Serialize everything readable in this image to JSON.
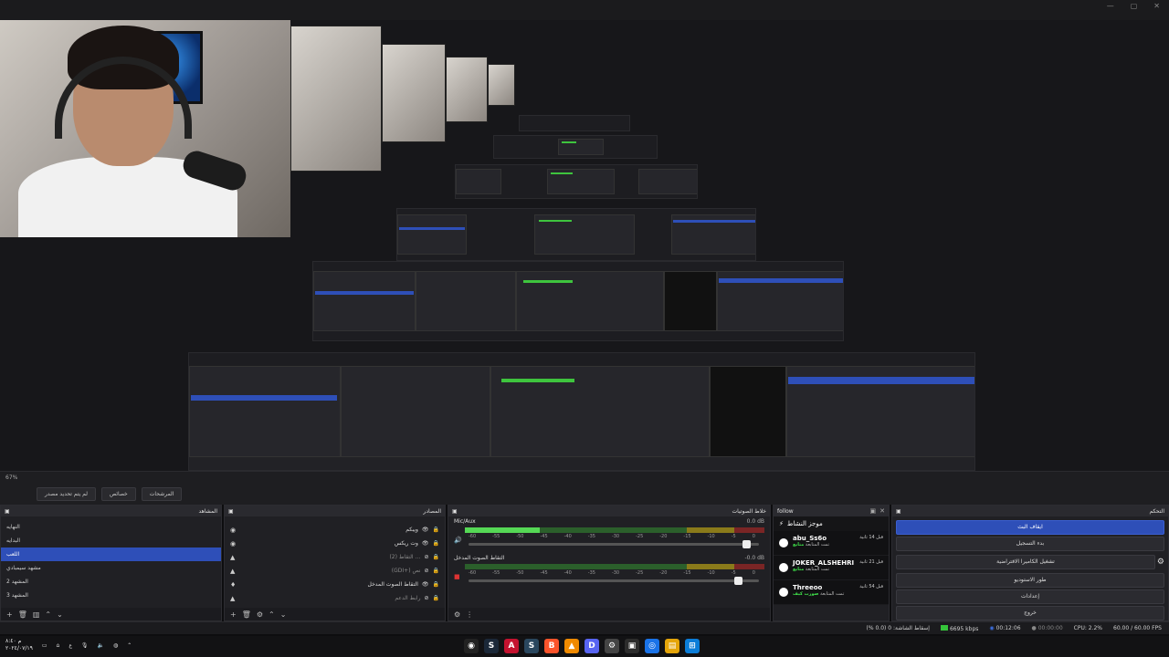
{
  "zoom_label": "67%",
  "top_tabs": [
    "لم يتم تحديد مصدر",
    "خصائص",
    "المرشحات"
  ],
  "docks": {
    "scenes": {
      "title": "المشاهد",
      "items": [
        "النهايه",
        "البدايه",
        "اللعب",
        "مشهد سيمبادي",
        "المشهد 2",
        "المشهد 3"
      ],
      "active_index": 2
    },
    "sources": {
      "title": "المصادر",
      "items": [
        "ويبكم",
        "وت ريكس",
        "(2) التقاط …",
        "(GDI+) نص",
        "التقاط الصوت المدخل",
        "رابط الدعم"
      ]
    },
    "mixer": {
      "title": "خلاط الصوتيات",
      "tracks": [
        {
          "name": "Mic/Aux",
          "db": "0.0 dB",
          "level": 0.25,
          "fader": 0.96
        },
        {
          "name": "التقاط الصوت المدخل",
          "db": "-0.0 dB",
          "level": 0.0,
          "fader": 0.93
        }
      ],
      "ticks": [
        "-60",
        "-55",
        "-50",
        "-45",
        "-40",
        "-35",
        "-30",
        "-25",
        "-20",
        "-15",
        "-10",
        "-5",
        "0"
      ]
    },
    "chat": {
      "title": "follow",
      "header": "موجز النشاط",
      "messages": [
        {
          "user": "abu_Ss6o",
          "sub_prefix": "تمت المتابعة",
          "sub_tag": "متابع",
          "time": "قبل 14 ثانية"
        },
        {
          "user": "JOKER_ALSHEHRI",
          "sub_prefix": "تمت المتابعة",
          "sub_tag": "متابع",
          "time": "قبل 21 ثانية"
        },
        {
          "user": "Threeoo",
          "sub_prefix": "تمت المتابعة",
          "sub_tag": "صورت كيف",
          "time": "قبل 54 ثانية"
        }
      ]
    },
    "controls": {
      "title": "التحكم",
      "buttons": [
        "ايقاف البث",
        "بدء التسجيل",
        "تشغيل الكاميرا الافتراضية",
        "طور الاستوديو",
        "إعدادات",
        "خروج"
      ]
    }
  },
  "status": {
    "dropped": "إسقاط الشاشة: 0 (0.0 %)",
    "bitrate": "6695 kbps",
    "live_time": "00:12:06",
    "rec_time": "00:00:00",
    "cpu": "CPU: 2.2%",
    "fps": "60.00 / 60.00 FPS"
  },
  "taskbar": {
    "time": "م ٨:٤٠",
    "date": "٢٠٢٤/٠٧/١٩",
    "apps": [
      {
        "name": "obs-icon",
        "glyph": "◉",
        "color": "#222"
      },
      {
        "name": "steam-icon",
        "glyph": "S",
        "color": "#1b2838"
      },
      {
        "name": "adobe-icon",
        "glyph": "A",
        "color": "#c4122f"
      },
      {
        "name": "steam-icon-2",
        "glyph": "S",
        "color": "#2a475e"
      },
      {
        "name": "brave-icon",
        "glyph": "B",
        "color": "#fb542b"
      },
      {
        "name": "vlc-icon",
        "glyph": "▲",
        "color": "#f08a00"
      },
      {
        "name": "discord-icon",
        "glyph": "D",
        "color": "#5865f2"
      },
      {
        "name": "settings-icon",
        "glyph": "⚙",
        "color": "#444"
      },
      {
        "name": "store-icon",
        "glyph": "▣",
        "color": "#2c2c2c"
      },
      {
        "name": "chrome-icon",
        "glyph": "◎",
        "color": "#1a73e8"
      },
      {
        "name": "folder-icon",
        "glyph": "▤",
        "color": "#e5a50a"
      },
      {
        "name": "windows-icon",
        "glyph": "⊞",
        "color": "#0b7dd8"
      }
    ]
  }
}
